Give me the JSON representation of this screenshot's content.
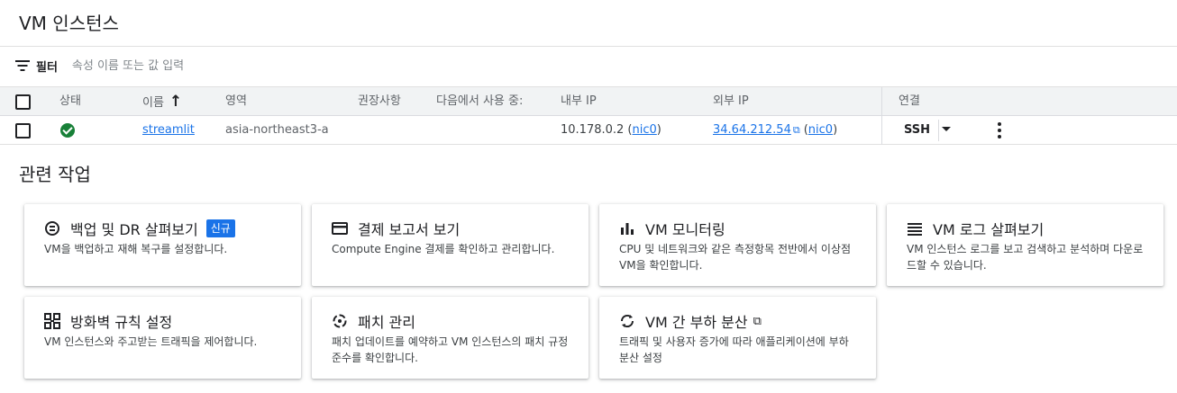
{
  "page": {
    "title": "VM 인스턴스"
  },
  "filter": {
    "label": "필터",
    "placeholder": "속성 이름 또는 값 입력"
  },
  "table": {
    "headers": {
      "status": "상태",
      "name": "이름",
      "zone": "영역",
      "recommendation": "권장사항",
      "in_use_by": "다음에서 사용 중:",
      "internal_ip": "내부 IP",
      "external_ip": "외부 IP",
      "connect": "연결"
    },
    "sort_arrow": "↑",
    "rows": [
      {
        "status": "running",
        "name": "streamlit",
        "zone": "asia-northeast3-a",
        "internal_ip": "10.178.0.2",
        "internal_nic": "nic0",
        "external_ip": "34.64.212.54",
        "external_nic": "nic0",
        "connect": "SSH"
      }
    ]
  },
  "related": {
    "title": "관련 작업",
    "cards": [
      {
        "icon": "backup-dr-icon",
        "title": "백업 및 DR 살펴보기",
        "badge": "신규",
        "desc": "VM을 백업하고 재해 복구를 설정합니다."
      },
      {
        "icon": "billing-icon",
        "title": "결제 보고서 보기",
        "desc": "Compute Engine 결제를 확인하고 관리합니다."
      },
      {
        "icon": "monitoring-bar-chart-icon",
        "title": "VM 모니터링",
        "desc": "CPU 및 네트워크와 같은 측정항목 전반에서 이상점 VM을 확인합니다."
      },
      {
        "icon": "logs-list-icon",
        "title": "VM 로그 살펴보기",
        "desc": "VM 인스턴스 로그를 보고 검색하고 분석하며 다운로드할 수 있습니다."
      },
      {
        "icon": "firewall-icon",
        "title": "방화벽 규칙 설정",
        "desc": "VM 인스턴스와 주고받는 트래픽을 제어합니다."
      },
      {
        "icon": "patch-icon",
        "title": "패치 관리",
        "desc": "패치 업데이트를 예약하고 VM 인스턴스의 패치 규정 준수를 확인합니다."
      },
      {
        "icon": "load-balancing-icon",
        "title": "VM 간 부하 분산",
        "desc": "트래픽 및 사용자 증가에 따라 애플리케이션에 부하 분산 설정"
      }
    ]
  },
  "colors": {
    "link": "#1a73e8",
    "status_ok": "#188038",
    "header_bg": "#f1f3f4",
    "badge": "#1a73e8"
  }
}
